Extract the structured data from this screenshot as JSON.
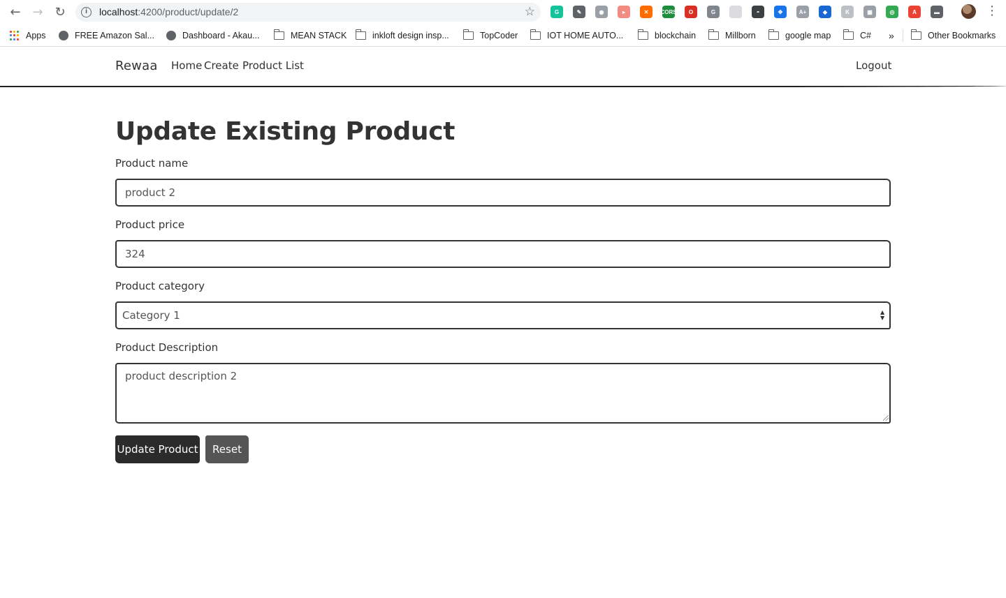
{
  "browser": {
    "url_host": "localhost",
    "url_path": ":4200/product/update/2",
    "extensions": [
      {
        "name": "grammarly-icon",
        "color": "#15c39a",
        "glyph": "G"
      },
      {
        "name": "eyedropper-icon",
        "color": "#5f6368",
        "glyph": "✎"
      },
      {
        "name": "camera-icon",
        "color": "#9aa0a6",
        "glyph": "◉"
      },
      {
        "name": "screencast-icon",
        "color": "#f28b82",
        "glyph": "▸"
      },
      {
        "name": "orange-extension-icon",
        "color": "#ff6d00",
        "glyph": "✕"
      },
      {
        "name": "cors-icon",
        "color": "#1e8e3e",
        "glyph": "CORS"
      },
      {
        "name": "opera-icon",
        "color": "#d93025",
        "glyph": "O"
      },
      {
        "name": "g-extension-icon",
        "color": "#80868b",
        "glyph": "G"
      },
      {
        "name": "blank-extension-icon",
        "color": "#dadce0",
        "glyph": ""
      },
      {
        "name": "incognito-extension-icon",
        "color": "#3c4043",
        "glyph": "◓"
      },
      {
        "name": "blue-extension-icon",
        "color": "#1a73e8",
        "glyph": "✥"
      },
      {
        "name": "font-scout-icon",
        "color": "#9aa0a6",
        "glyph": "A+"
      },
      {
        "name": "diamond-extension-icon",
        "color": "#1967d2",
        "glyph": "◆"
      },
      {
        "name": "k-extension-icon",
        "color": "#bdc1c6",
        "glyph": "K"
      },
      {
        "name": "calendar-extension-icon",
        "color": "#9aa0a6",
        "glyph": "▦"
      },
      {
        "name": "circle-extension-icon",
        "color": "#34a853",
        "glyph": "◎"
      },
      {
        "name": "pro-extension-icon",
        "color": "#ea4335",
        "glyph": "A"
      },
      {
        "name": "monitor-extension-icon",
        "color": "#5f6368",
        "glyph": "▬"
      }
    ]
  },
  "bookmarks": {
    "items": [
      {
        "label": "Apps",
        "icon": "apps-grid-icon"
      },
      {
        "label": "FREE Amazon Sal...",
        "icon": "globe-icon"
      },
      {
        "label": "Dashboard - Akau...",
        "icon": "globe-icon"
      },
      {
        "label": "MEAN STACK",
        "icon": "folder-icon"
      },
      {
        "label": "inkloft design insp...",
        "icon": "folder-icon"
      },
      {
        "label": "TopCoder",
        "icon": "folder-icon"
      },
      {
        "label": "IOT HOME AUTO...",
        "icon": "folder-icon"
      },
      {
        "label": "blockchain",
        "icon": "folder-icon"
      },
      {
        "label": "Millborn",
        "icon": "folder-icon"
      },
      {
        "label": "google map",
        "icon": "folder-icon"
      },
      {
        "label": "C#",
        "icon": "folder-icon"
      }
    ],
    "overflow": "»",
    "other": "Other Bookmarks"
  },
  "nav": {
    "brand": "Rewaa",
    "links": [
      "Home",
      "Create",
      "Product List"
    ],
    "logout": "Logout"
  },
  "form": {
    "title": "Update Existing Product",
    "name_label": "Product name",
    "name_value": "product 2",
    "price_label": "Product price",
    "price_value": "324",
    "category_label": "Product category",
    "category_value": "Category 1",
    "description_label": "Product Description",
    "description_value": "product description 2",
    "submit_label": "Update Product",
    "reset_label": "Reset"
  }
}
